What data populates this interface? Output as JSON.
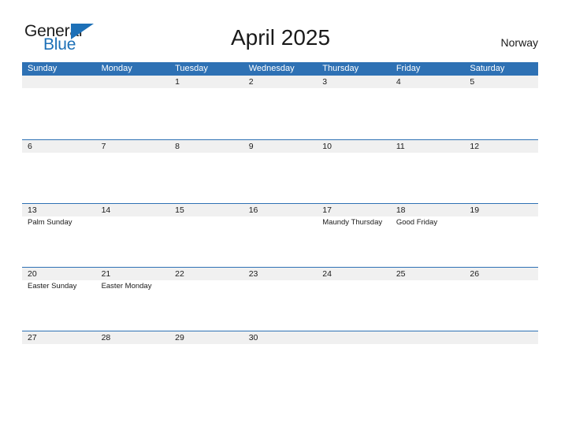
{
  "logo": {
    "word_one": "General",
    "word_two": "Blue",
    "triangle_color": "#1d70b7"
  },
  "header": {
    "title": "April 2025",
    "country": "Norway",
    "header_bar_color": "#2e71b4",
    "band_color": "#f0f0f0"
  },
  "calendar": {
    "weekdays": [
      "Sunday",
      "Monday",
      "Tuesday",
      "Wednesday",
      "Thursday",
      "Friday",
      "Saturday"
    ],
    "weeks": [
      [
        {
          "day": ""
        },
        {
          "day": ""
        },
        {
          "day": "1",
          "events": []
        },
        {
          "day": "2",
          "events": []
        },
        {
          "day": "3",
          "events": []
        },
        {
          "day": "4",
          "events": []
        },
        {
          "day": "5",
          "events": []
        }
      ],
      [
        {
          "day": "6",
          "events": []
        },
        {
          "day": "7",
          "events": []
        },
        {
          "day": "8",
          "events": []
        },
        {
          "day": "9",
          "events": []
        },
        {
          "day": "10",
          "events": []
        },
        {
          "day": "11",
          "events": []
        },
        {
          "day": "12",
          "events": []
        }
      ],
      [
        {
          "day": "13",
          "events": [
            "Palm Sunday"
          ]
        },
        {
          "day": "14",
          "events": []
        },
        {
          "day": "15",
          "events": []
        },
        {
          "day": "16",
          "events": []
        },
        {
          "day": "17",
          "events": [
            "Maundy Thursday"
          ]
        },
        {
          "day": "18",
          "events": [
            "Good Friday"
          ]
        },
        {
          "day": "19",
          "events": []
        }
      ],
      [
        {
          "day": "20",
          "events": [
            "Easter Sunday"
          ]
        },
        {
          "day": "21",
          "events": [
            "Easter Monday"
          ]
        },
        {
          "day": "22",
          "events": []
        },
        {
          "day": "23",
          "events": []
        },
        {
          "day": "24",
          "events": []
        },
        {
          "day": "25",
          "events": []
        },
        {
          "day": "26",
          "events": []
        }
      ],
      [
        {
          "day": "27",
          "events": []
        },
        {
          "day": "28",
          "events": []
        },
        {
          "day": "29",
          "events": []
        },
        {
          "day": "30",
          "events": []
        },
        {
          "day": ""
        },
        {
          "day": ""
        },
        {
          "day": ""
        }
      ]
    ]
  }
}
